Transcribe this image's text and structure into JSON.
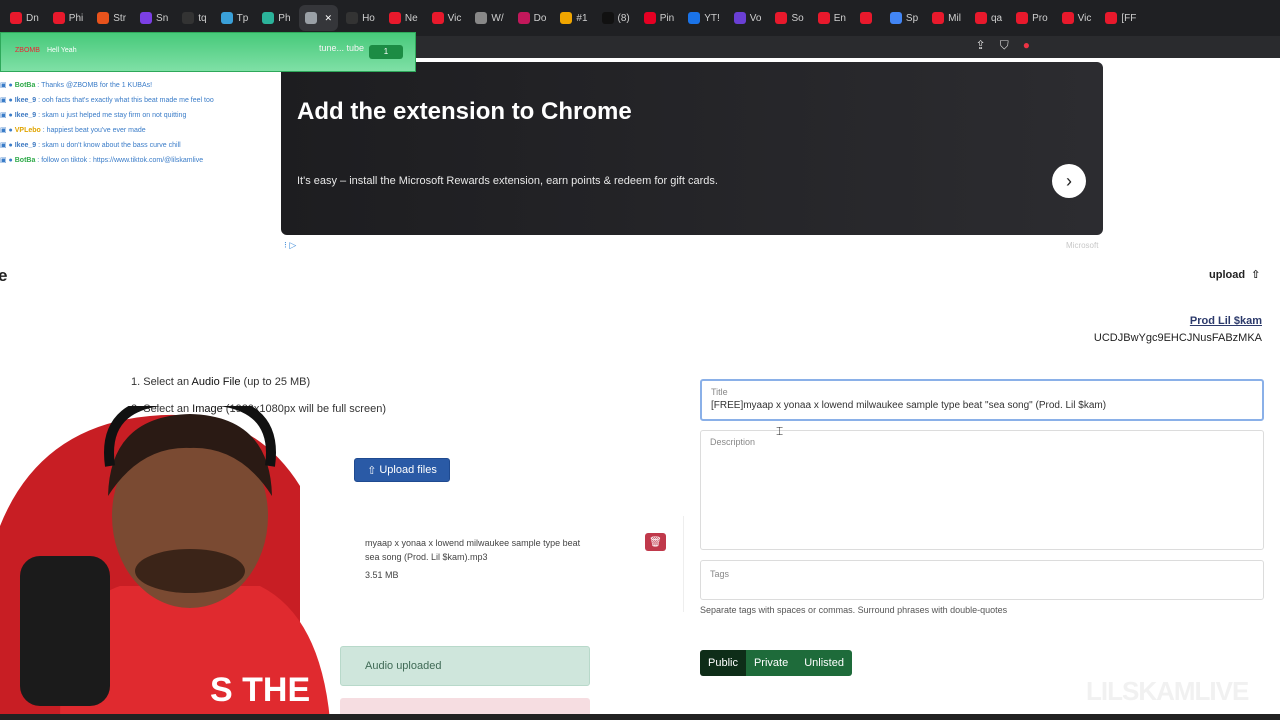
{
  "browser": {
    "tabs": [
      {
        "label": "Dn",
        "color": "#e8192c"
      },
      {
        "label": "Phi",
        "color": "#e8192c"
      },
      {
        "label": "Str",
        "color": "#e8531c"
      },
      {
        "label": "Sn",
        "color": "#7b3fe4"
      },
      {
        "label": "tq",
        "color": "#333333"
      },
      {
        "label": "Tp",
        "color": "#3aa0d8"
      },
      {
        "label": "Ph",
        "color": "#2bb39a"
      },
      {
        "label": "",
        "color": "#9aa0a6"
      },
      {
        "label": "Ho",
        "color": "#333333"
      },
      {
        "label": "Ne",
        "color": "#e8192c"
      },
      {
        "label": "Vic",
        "color": "#e8192c"
      },
      {
        "label": "W/",
        "color": "#888888"
      },
      {
        "label": "Do",
        "color": "#c2185b"
      },
      {
        "label": "#1",
        "color": "#f0a500"
      },
      {
        "label": "(8)",
        "color": "#111111"
      },
      {
        "label": "Pin",
        "color": "#e60023"
      },
      {
        "label": "YT!",
        "color": "#1a73e8"
      },
      {
        "label": "Vo",
        "color": "#6a3fd4"
      },
      {
        "label": "So",
        "color": "#e8192c"
      },
      {
        "label": "En",
        "color": "#e8192c"
      },
      {
        "label": "",
        "color": "#e8192c"
      },
      {
        "label": "Sp",
        "color": "#4285f4"
      },
      {
        "label": "Mil",
        "color": "#e8192c"
      },
      {
        "label": "qa",
        "color": "#e8192c"
      },
      {
        "label": "Pro",
        "color": "#e8192c"
      },
      {
        "label": "Vic",
        "color": "#e8192c"
      },
      {
        "label": "[FF",
        "color": "#e8192c"
      }
    ]
  },
  "stream_overlay": {
    "top_user": "ZBOMB",
    "top_message": "Hell Yeah",
    "tune_text": "tune... tube",
    "badge": "1",
    "chat": [
      {
        "name": "BotBa",
        "text": "Thanks @ZBOMB for the 1 KUBAs!",
        "style": "g"
      },
      {
        "name": "Ikee_9",
        "text": "ooh facts that's exactly what this beat made me feel too",
        "style": "b"
      },
      {
        "name": "Ikee_9",
        "text": "skam u just helped me stay firm on not quitting",
        "style": "b"
      },
      {
        "name": "VPLebo",
        "text": "happiest beat you've ever made",
        "style": "y"
      },
      {
        "name": "Ikee_9",
        "text": "skam u don't know about the bass curve chill",
        "style": "b"
      },
      {
        "name": "BotBa",
        "text": "follow on tiktok : https://www.tiktok.com/@lilskamlive",
        "style": "g"
      }
    ]
  },
  "ad": {
    "headline": "Add the extension to Chrome",
    "body": "It's easy – install the Microsoft Rewards extension, earn points & redeem for gift cards.",
    "sponsor": "Microsoft",
    "arrow": "›",
    "adchoice": "⁝ ▷"
  },
  "page": {
    "logo_fragment": "e",
    "upload_label": "upload",
    "channel_name": "Prod Lil $kam",
    "channel_id": "UCDJBwYgc9EHCJNusFABzMKA"
  },
  "steps": {
    "step1_prefix": "1. Select an ",
    "step1_bold": "Audio File",
    "step1_suffix": " (up to 25 MB)",
    "step2_prefix": "2. Select an ",
    "step2_bold": "Image",
    "step2_suffix": " (1920x1080px will be full screen)"
  },
  "upload_button": "Upload files",
  "file": {
    "name": "myaap x yonaa x lowend milwaukee sample type beat sea song (Prod. Lil $kam).mp3",
    "size": "3.51 MB"
  },
  "audio_status": "Audio uploaded",
  "form": {
    "title_label": "Title",
    "title_value": "[FREE]myaap x yonaa x lowend milwaukee sample type beat \"sea song\" (Prod. Lil $kam)",
    "description_label": "Description",
    "tags_label": "Tags",
    "tags_help": "Separate tags with spaces or commas. Surround phrases with double-quotes",
    "visibility": [
      {
        "label": "Public",
        "selected": true
      },
      {
        "label": "Private",
        "selected": false
      },
      {
        "label": "Unlisted",
        "selected": false
      }
    ]
  },
  "watermark": "LILSKAMLIVE"
}
